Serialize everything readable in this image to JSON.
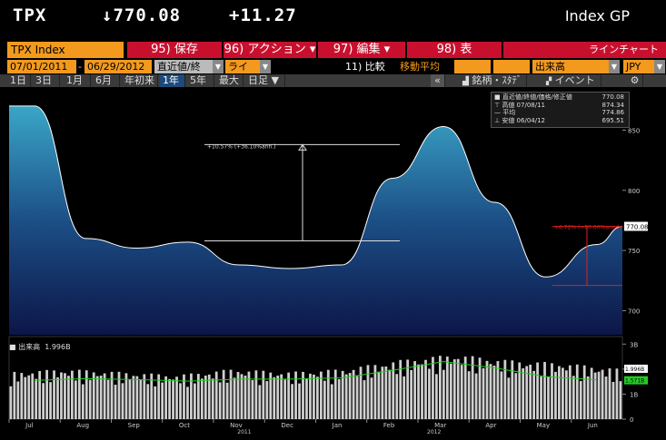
{
  "header": {
    "ticker": "TPX",
    "price": "↓770.08",
    "change": "+11.27",
    "security_type": "Index GP"
  },
  "toolbar": {
    "security": "TPX Index",
    "buttons": [
      {
        "label": "95) 保存",
        "arrow": ""
      },
      {
        "label": "96) アクション",
        "arrow": "▾"
      },
      {
        "label": "97) 編集",
        "arrow": "▾"
      },
      {
        "label": "98) 表",
        "arrow": ""
      },
      {
        "label": "ラインチャート",
        "arrow": ""
      }
    ],
    "start_date": "07/01/2011",
    "end_date": "06/29/2012",
    "price_type": "直近値/終",
    "line_type": "ライン",
    "compare": "11) 比較",
    "moving_avg": "移動平均",
    "volume": "出来高",
    "currency": "JPY"
  },
  "periods": [
    {
      "label": "1日",
      "selected": false
    },
    {
      "label": "3日",
      "selected": false
    },
    {
      "label": "1月",
      "selected": false
    },
    {
      "label": "6月",
      "selected": false
    },
    {
      "label": "年初来",
      "selected": false
    },
    {
      "label": "1年",
      "selected": true
    },
    {
      "label": "5年",
      "selected": false
    },
    {
      "label": "最大",
      "selected": false
    },
    {
      "label": "日足 ▼",
      "selected": false
    }
  ],
  "tools": {
    "collapse": "«",
    "studies": "銘柄・ｽﾀﾃﾞｨ",
    "events": "イベント",
    "settings_icon": "gear-icon"
  },
  "legend": {
    "items": [
      {
        "label": "■ 直近値/終値/価格/修正値",
        "value": "770.08"
      },
      {
        "label": "⊤ 高値 07/08/11",
        "value": "874.34"
      },
      {
        "label": "— 平均",
        "value": "774.86"
      },
      {
        "label": "⊥ 安値 06/04/12",
        "value": "695.51"
      }
    ]
  },
  "annotations": {
    "left_change": "+10.57% (+36.10%ann.)",
    "right_change": "+6.72% (+80.00%ann.)"
  },
  "price_axis": {
    "ticks": [
      "850",
      "800",
      "750",
      "700"
    ],
    "last_label": "770.08"
  },
  "volume_panel": {
    "label": "出来高",
    "value": "1.996B",
    "ticks": [
      "3B",
      "2B",
      "1B",
      "0"
    ],
    "last_label": "1.996B",
    "ma_label": "1.571B"
  },
  "x_axis": {
    "months": [
      "Jul",
      "Aug",
      "Sep",
      "Oct",
      "Nov",
      "Dec",
      "Jan",
      "Feb",
      "Mar",
      "Apr",
      "May",
      "Jun"
    ],
    "years": [
      "2011",
      "2012"
    ]
  },
  "colors": {
    "accent_orange": "#f39a1e",
    "button_red": "#c8102e",
    "selected_blue": "#1e4a7a",
    "volume_ma": "#22cc22",
    "annotation_red": "#e02020"
  },
  "chart_data": {
    "type": "area",
    "x": [
      "2011-07",
      "2011-08",
      "2011-09",
      "2011-10",
      "2011-11",
      "2011-12",
      "2012-01",
      "2012-02",
      "2012-03",
      "2012-04",
      "2012-05",
      "2012-06"
    ],
    "y": [
      870,
      760,
      752,
      757,
      738,
      735,
      738,
      810,
      853,
      790,
      728,
      755
    ],
    "ylim": [
      680,
      885
    ],
    "last": 770.08,
    "high": 874.34,
    "low": 695.51,
    "average": 774.86,
    "volume_ylim": [
      0,
      3.3
    ],
    "volume": [
      1.6,
      1.7,
      1.6,
      1.5,
      1.7,
      1.6,
      1.7,
      2.0,
      2.2,
      2.0,
      1.9,
      1.7
    ],
    "volume_ma": [
      1.55,
      1.62,
      1.58,
      1.52,
      1.6,
      1.6,
      1.65,
      1.95,
      2.3,
      2.05,
      1.7,
      1.571
    ]
  }
}
